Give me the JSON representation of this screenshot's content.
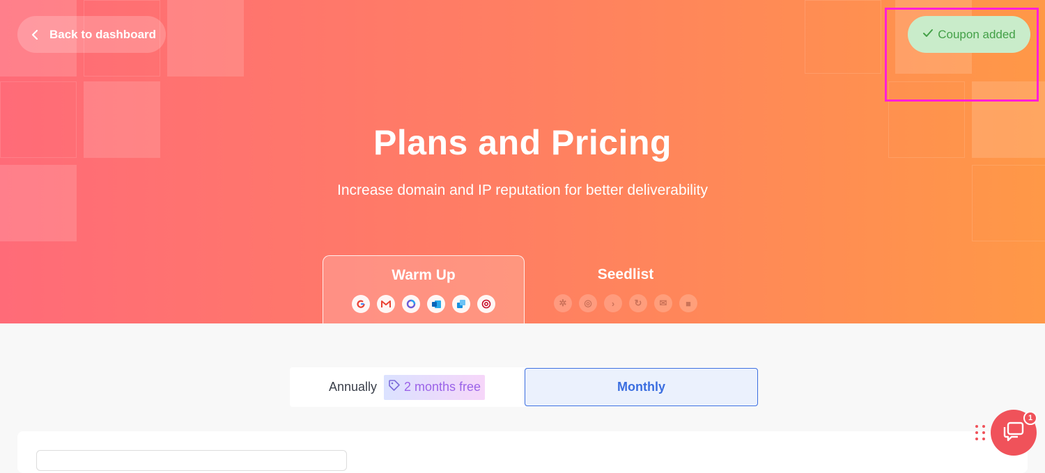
{
  "header": {
    "back_label": "Back to dashboard",
    "coupon_label": "Coupon added",
    "title": "Plans and Pricing",
    "subtitle": "Increase domain and IP reputation for better deliverability"
  },
  "tabs": [
    {
      "label": "Warm Up",
      "active": true,
      "icons": [
        "google-icon",
        "gmail-icon",
        "microsoft-icon",
        "outlook-icon",
        "exchange-icon",
        "email-provider-icon"
      ]
    },
    {
      "label": "Seedlist",
      "active": false,
      "icons": [
        "hubspot-icon",
        "provider-icon",
        "arrow-provider-icon",
        "refresh-provider-icon",
        "mail-icon",
        "brand-icon"
      ]
    }
  ],
  "billing": {
    "annual_label": "Annually",
    "promo_label": "2 months free",
    "monthly_label": "Monthly",
    "selected": "Monthly"
  },
  "chat": {
    "badge_count": "1"
  },
  "colors": {
    "hero_start": "#ff6b78",
    "hero_end": "#ff9847",
    "accent_blue": "#3b6ee0",
    "coupon_green": "#43a047",
    "chat_red": "#f0525a"
  }
}
